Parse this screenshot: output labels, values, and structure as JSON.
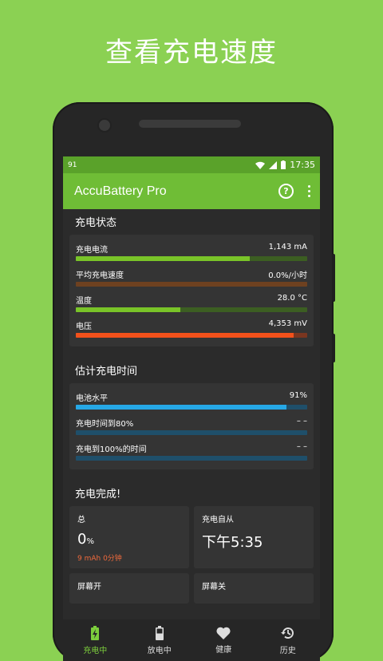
{
  "promo_title": "查看充电速度",
  "status_bar": {
    "notification": "91",
    "time": "17:35"
  },
  "app_bar": {
    "title": "AccuBattery Pro",
    "help_icon": "?"
  },
  "section1": {
    "title": "充电状态",
    "metrics": [
      {
        "label": "充电电流",
        "value": "1,143 mA",
        "fill": 0.75,
        "color": "#79c428",
        "track": "#3c5e22"
      },
      {
        "label": "平均充电速度",
        "value": "0.0%/小时",
        "fill": 0.0,
        "color": "#e37a2b",
        "track": "#6e4120"
      },
      {
        "label": "温度",
        "value": "28.0 °C",
        "fill": 0.45,
        "color": "#79c428",
        "track": "#3c5e22"
      },
      {
        "label": "电压",
        "value": "4,353 mV",
        "fill": 0.94,
        "color": "#f2511b",
        "track": "#7a3620"
      }
    ]
  },
  "section2": {
    "title": "估计充电时间",
    "metrics": [
      {
        "label": "电池水平",
        "value": "91%",
        "fill": 0.91,
        "color": "#26a8e6",
        "track": "#1f4f6a"
      },
      {
        "label": "充电时间到80%",
        "value": "– –",
        "fill": 0.0,
        "color": "#26a8e6",
        "track": "#1f4f6a"
      },
      {
        "label": "充电到100%的时间",
        "value": "– –",
        "fill": 0.0,
        "color": "#26a8e6",
        "track": "#1f4f6a"
      }
    ]
  },
  "section3": {
    "title": "充电完成!",
    "tiles": {
      "total_label": "总",
      "total_value": "0",
      "total_unit": "%",
      "total_sub": "9 mAh 0分钟",
      "since_label": "充电自从",
      "since_value": "下午5:35",
      "screen_on_label": "屏幕开",
      "screen_off_label": "屏幕关"
    }
  },
  "bottom_nav": [
    {
      "label": "充电中",
      "icon": "battery-charging-icon",
      "active": true
    },
    {
      "label": "放电中",
      "icon": "battery-discharging-icon",
      "active": false
    },
    {
      "label": "健康",
      "icon": "heart-icon",
      "active": false
    },
    {
      "label": "历史",
      "icon": "history-icon",
      "active": false
    }
  ]
}
